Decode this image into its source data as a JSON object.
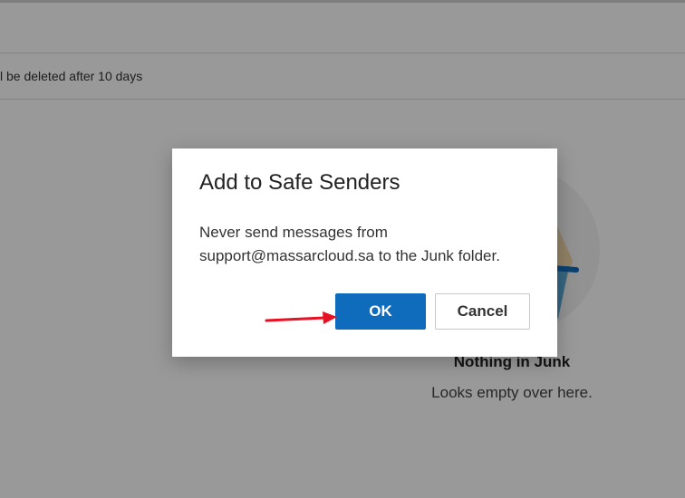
{
  "page": {
    "notice_text": "l be deleted after 10 days"
  },
  "empty_state": {
    "title": "Nothing in Junk",
    "subtitle": "Looks empty over here."
  },
  "dialog": {
    "title": "Add to Safe Senders",
    "message_line1": "Never send messages from",
    "message_line2": "support@massarcloud.sa to the Junk folder.",
    "ok_label": "OK",
    "cancel_label": "Cancel"
  },
  "colors": {
    "primary_button": "#0f6cbd",
    "annotation_arrow": "#e81123"
  }
}
